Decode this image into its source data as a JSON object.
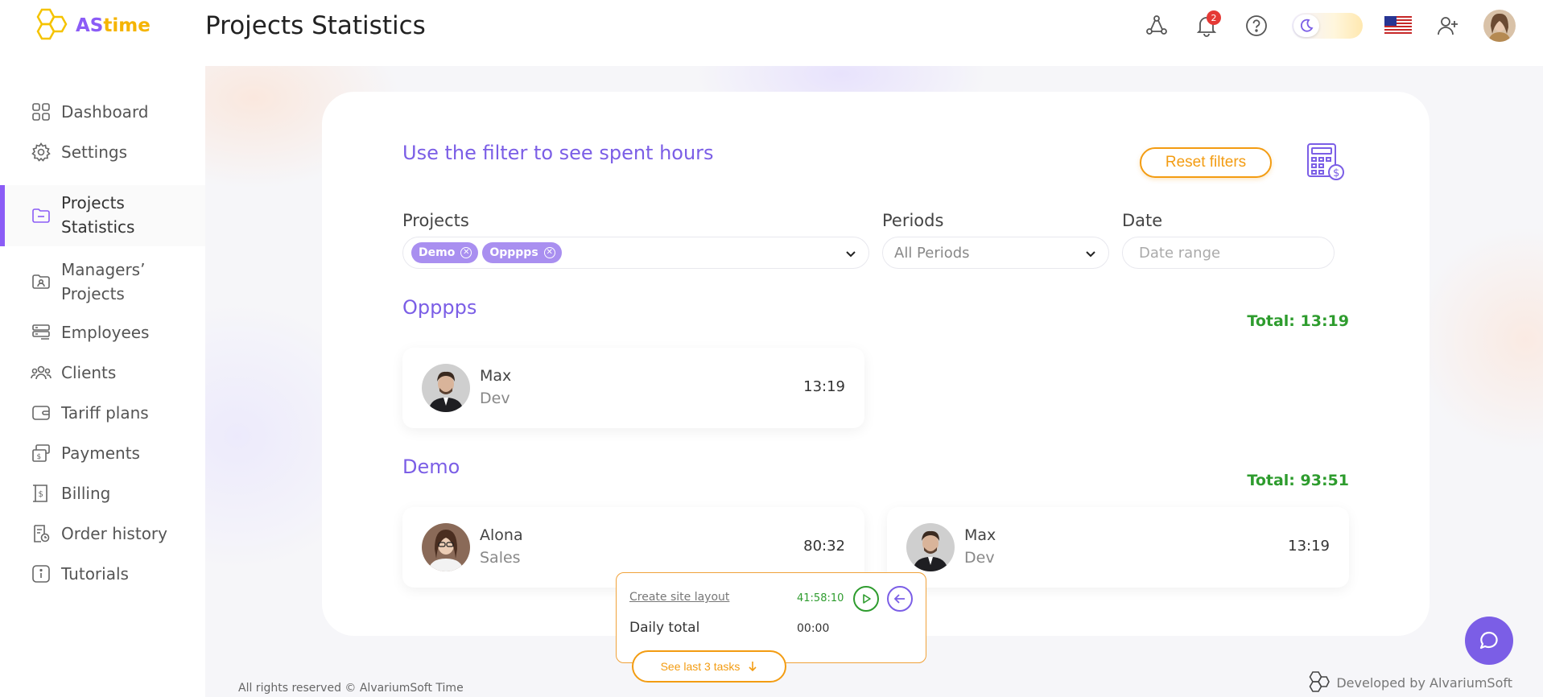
{
  "header": {
    "logo_as": "AS",
    "logo_time": "time",
    "title": "Projects Statistics",
    "notifications_count": "2",
    "icons": [
      "network-icon",
      "bell-icon",
      "help-icon",
      "moon-icon",
      "us-flag-icon",
      "add-user-icon"
    ]
  },
  "sidebar": {
    "items": [
      {
        "label": "Dashboard",
        "icon": "grid-icon"
      },
      {
        "label": "Settings",
        "icon": "gear-icon"
      },
      {
        "label_line1": "Projects",
        "label_line2": "Statistics",
        "icon": "folder-icon",
        "active": true
      },
      {
        "label_line1": "Managers’",
        "label_line2": "Projects",
        "icon": "manager-icon"
      },
      {
        "label": "Employees",
        "icon": "employees-icon"
      },
      {
        "label": "Clients",
        "icon": "clients-icon"
      },
      {
        "label": "Tariff plans",
        "icon": "wallet-icon"
      },
      {
        "label": "Payments",
        "icon": "payments-icon"
      },
      {
        "label": "Billing",
        "icon": "billing-icon"
      },
      {
        "label": "Order history",
        "icon": "order-history-icon"
      },
      {
        "label": "Tutorials",
        "icon": "info-icon"
      }
    ]
  },
  "filters": {
    "hint": "Use the filter to see spent hours",
    "reset_label": "Reset filters",
    "projects_label": "Projects",
    "selected_projects": [
      "Demo",
      "Opppps"
    ],
    "periods_label": "Periods",
    "periods_value": "All Periods",
    "date_label": "Date",
    "date_placeholder": "Date range"
  },
  "projects": [
    {
      "name": "Opppps",
      "total": "Total: 13:19",
      "employees": [
        {
          "name": "Max",
          "role": "Dev",
          "time": "13:19"
        }
      ]
    },
    {
      "name": "Demo",
      "total": "Total: 93:51",
      "employees": [
        {
          "name": "Alona",
          "role": "Sales",
          "time": "80:32"
        },
        {
          "name": "Max",
          "role": "Dev",
          "time": "13:19"
        }
      ]
    }
  ],
  "timer": {
    "task": "Create site layout",
    "task_time": "41:58:10",
    "daily_label": "Daily total",
    "daily_value": "00:00",
    "last_tasks_label": "See last 3 tasks"
  },
  "footer": {
    "copyright": "All rights reserved © AlvariumSoft Time",
    "developed": "Developed by AlvariumSoft"
  },
  "colors": {
    "accent": "#7b5ee6",
    "orange": "#f39c12",
    "green": "#2e9c2e"
  }
}
